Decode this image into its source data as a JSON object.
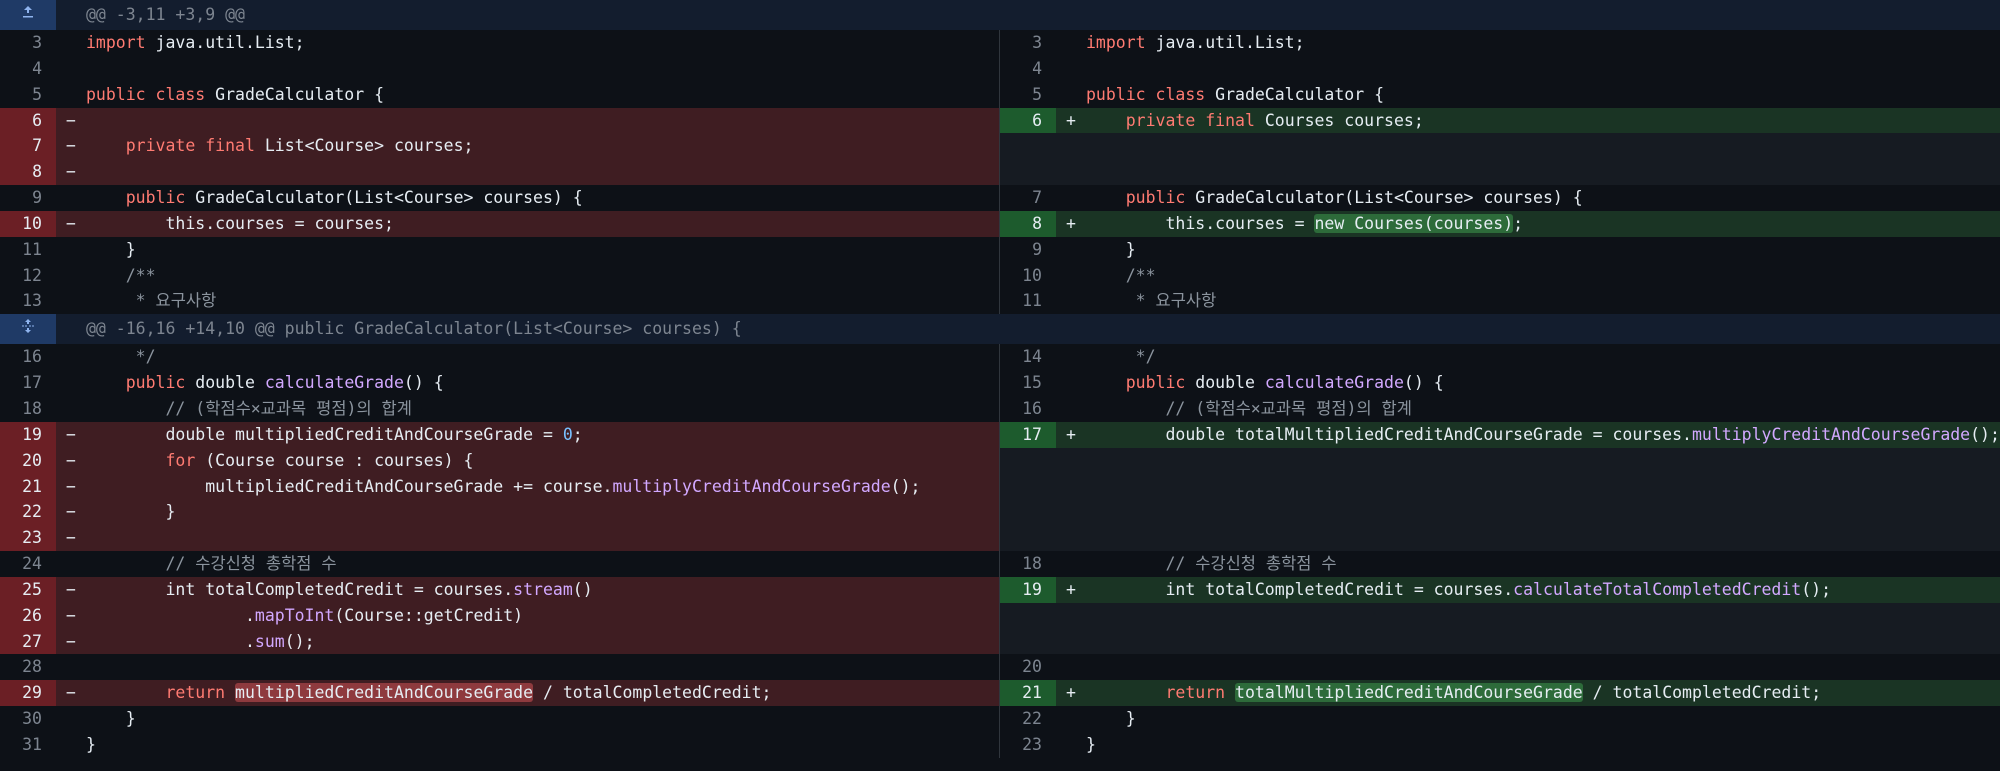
{
  "hunks": [
    {
      "header": "@@ -3,11 +3,9 @@",
      "rows": [
        {
          "l": {
            "n": "3",
            "t": "ctx",
            "s": [
              [
                "kw",
                "import "
              ],
              [
                "",
                "java.util.List;"
              ]
            ]
          },
          "r": {
            "n": "3",
            "t": "ctx",
            "s": [
              [
                "kw",
                "import "
              ],
              [
                "",
                "java.util.List;"
              ]
            ]
          }
        },
        {
          "l": {
            "n": "4",
            "t": "ctx",
            "s": []
          },
          "r": {
            "n": "4",
            "t": "ctx",
            "s": []
          }
        },
        {
          "l": {
            "n": "5",
            "t": "ctx",
            "s": [
              [
                "kw",
                "public class "
              ],
              [
                "",
                "GradeCalculator {"
              ]
            ]
          },
          "r": {
            "n": "5",
            "t": "ctx",
            "s": [
              [
                "kw",
                "public class "
              ],
              [
                "",
                "GradeCalculator {"
              ]
            ]
          }
        },
        {
          "l": {
            "n": "6",
            "t": "del",
            "s": []
          },
          "r": {
            "n": "6",
            "t": "add",
            "s": [
              [
                "",
                "    "
              ],
              [
                "kw",
                "private final "
              ],
              [
                "",
                "Courses courses;"
              ]
            ]
          }
        },
        {
          "l": {
            "n": "7",
            "t": "del",
            "s": [
              [
                "",
                "    "
              ],
              [
                "kw",
                "private final "
              ],
              [
                "",
                "List<Course> courses;"
              ]
            ]
          },
          "r": {
            "t": "empty"
          }
        },
        {
          "l": {
            "n": "8",
            "t": "del",
            "s": []
          },
          "r": {
            "t": "empty"
          }
        },
        {
          "l": {
            "n": "9",
            "t": "ctx",
            "s": [
              [
                "",
                "    "
              ],
              [
                "kw",
                "public "
              ],
              [
                "",
                "GradeCalculator(List<Course> courses) {"
              ]
            ]
          },
          "r": {
            "n": "7",
            "t": "ctx",
            "s": [
              [
                "",
                "    "
              ],
              [
                "kw",
                "public "
              ],
              [
                "",
                "GradeCalculator(List<Course> courses) {"
              ]
            ]
          }
        },
        {
          "l": {
            "n": "10",
            "t": "del",
            "s": [
              [
                "",
                "        this.courses = courses;"
              ]
            ]
          },
          "r": {
            "n": "8",
            "t": "add",
            "s": [
              [
                "",
                "        this.courses = "
              ],
              [
                "hl-add",
                "new Courses(courses)"
              ],
              [
                "",
                ";"
              ]
            ]
          }
        },
        {
          "l": {
            "n": "11",
            "t": "ctx",
            "s": [
              [
                "",
                "    }"
              ]
            ]
          },
          "r": {
            "n": "9",
            "t": "ctx",
            "s": [
              [
                "",
                "    }"
              ]
            ]
          }
        },
        {
          "l": {
            "n": "12",
            "t": "ctx",
            "s": [
              [
                "cm",
                "    /**"
              ]
            ]
          },
          "r": {
            "n": "10",
            "t": "ctx",
            "s": [
              [
                "cm",
                "    /**"
              ]
            ]
          }
        },
        {
          "l": {
            "n": "13",
            "t": "ctx",
            "s": [
              [
                "cm",
                "     * 요구사항"
              ]
            ]
          },
          "r": {
            "n": "11",
            "t": "ctx",
            "s": [
              [
                "cm",
                "     * 요구사항"
              ]
            ]
          }
        }
      ]
    },
    {
      "header": "@@ -16,16 +14,10 @@ public GradeCalculator(List<Course> courses) {",
      "rows": [
        {
          "l": {
            "n": "16",
            "t": "ctx",
            "s": [
              [
                "cm",
                "     */"
              ]
            ]
          },
          "r": {
            "n": "14",
            "t": "ctx",
            "s": [
              [
                "cm",
                "     */"
              ]
            ]
          }
        },
        {
          "l": {
            "n": "17",
            "t": "ctx",
            "s": [
              [
                "",
                "    "
              ],
              [
                "kw",
                "public "
              ],
              [
                "",
                "double "
              ],
              [
                "fn",
                "calculateGrade"
              ],
              [
                "",
                "() {"
              ]
            ]
          },
          "r": {
            "n": "15",
            "t": "ctx",
            "s": [
              [
                "",
                "    "
              ],
              [
                "kw",
                "public "
              ],
              [
                "",
                "double "
              ],
              [
                "fn",
                "calculateGrade"
              ],
              [
                "",
                "() {"
              ]
            ]
          }
        },
        {
          "l": {
            "n": "18",
            "t": "ctx",
            "s": [
              [
                "cm",
                "        // (학점수×교과목 평점)의 합계"
              ]
            ]
          },
          "r": {
            "n": "16",
            "t": "ctx",
            "s": [
              [
                "cm",
                "        // (학점수×교과목 평점)의 합계"
              ]
            ]
          }
        },
        {
          "l": {
            "n": "19",
            "t": "del",
            "s": [
              [
                "",
                "        double multipliedCreditAndCourseGrade = "
              ],
              [
                "num-lit",
                "0"
              ],
              [
                "",
                ";"
              ]
            ]
          },
          "r": {
            "n": "17",
            "t": "add",
            "s": [
              [
                "",
                "        double totalMultipliedCreditAndCourseGrade = courses."
              ],
              [
                "fn",
                "multiplyCreditAndCourseGrade"
              ],
              [
                "",
                "();"
              ]
            ]
          }
        },
        {
          "l": {
            "n": "20",
            "t": "del",
            "s": [
              [
                "",
                "        "
              ],
              [
                "kw",
                "for "
              ],
              [
                "",
                "(Course course : courses) {"
              ]
            ]
          },
          "r": {
            "t": "empty"
          }
        },
        {
          "l": {
            "n": "21",
            "t": "del",
            "s": [
              [
                "",
                "            multipliedCreditAndCourseGrade += course."
              ],
              [
                "fn",
                "multiplyCreditAndCourseGrade"
              ],
              [
                "",
                "();"
              ]
            ]
          },
          "r": {
            "t": "empty"
          }
        },
        {
          "l": {
            "n": "22",
            "t": "del",
            "s": [
              [
                "",
                "        }"
              ]
            ]
          },
          "r": {
            "t": "empty"
          }
        },
        {
          "l": {
            "n": "23",
            "t": "del",
            "s": []
          },
          "r": {
            "t": "empty"
          }
        },
        {
          "l": {
            "n": "24",
            "t": "ctx",
            "s": [
              [
                "cm",
                "        // 수강신청 총학점 수"
              ]
            ]
          },
          "r": {
            "n": "18",
            "t": "ctx",
            "s": [
              [
                "cm",
                "        // 수강신청 총학점 수"
              ]
            ]
          }
        },
        {
          "l": {
            "n": "25",
            "t": "del",
            "s": [
              [
                "",
                "        int totalCompletedCredit = courses."
              ],
              [
                "fn",
                "stream"
              ],
              [
                "",
                "()"
              ]
            ]
          },
          "r": {
            "n": "19",
            "t": "add",
            "s": [
              [
                "",
                "        int totalCompletedCredit = courses."
              ],
              [
                "fn",
                "calculateTotalCompletedCredit"
              ],
              [
                "",
                "();"
              ]
            ]
          }
        },
        {
          "l": {
            "n": "26",
            "t": "del",
            "s": [
              [
                "",
                "                ."
              ],
              [
                "fn",
                "mapToInt"
              ],
              [
                "",
                "(Course::getCredit)"
              ]
            ]
          },
          "r": {
            "t": "empty"
          }
        },
        {
          "l": {
            "n": "27",
            "t": "del",
            "s": [
              [
                "",
                "                ."
              ],
              [
                "fn",
                "sum"
              ],
              [
                "",
                "();"
              ]
            ]
          },
          "r": {
            "t": "empty"
          }
        },
        {
          "l": {
            "n": "28",
            "t": "ctx",
            "s": []
          },
          "r": {
            "n": "20",
            "t": "ctx",
            "s": []
          }
        },
        {
          "l": {
            "n": "29",
            "t": "del",
            "s": [
              [
                "",
                "        "
              ],
              [
                "kw",
                "return "
              ],
              [
                "hl-del",
                "multipliedCreditAndCourseGrade"
              ],
              [
                "",
                " / totalCompletedCredit;"
              ]
            ]
          },
          "r": {
            "n": "21",
            "t": "add",
            "s": [
              [
                "",
                "        "
              ],
              [
                "kw",
                "return "
              ],
              [
                "hl-add",
                "totalMultipliedCreditAndCourseGrade"
              ],
              [
                "",
                " / totalCompletedCredit;"
              ]
            ]
          }
        },
        {
          "l": {
            "n": "30",
            "t": "ctx",
            "s": [
              [
                "",
                "    }"
              ]
            ]
          },
          "r": {
            "n": "22",
            "t": "ctx",
            "s": [
              [
                "",
                "    }"
              ]
            ]
          }
        },
        {
          "l": {
            "n": "31",
            "t": "ctx",
            "s": [
              [
                "",
                "}"
              ]
            ]
          },
          "r": {
            "n": "23",
            "t": "ctx",
            "s": [
              [
                "",
                "}"
              ]
            ]
          }
        }
      ]
    }
  ],
  "signs": {
    "del": "−",
    "add": "+",
    "ctx": ""
  },
  "icons": {
    "expand_up": "expand-up-icon",
    "expand_both": "expand-both-icon"
  },
  "colors": {
    "deleted": "#3f1d22",
    "added": "#1a3424",
    "hunk": "#131d2e"
  }
}
